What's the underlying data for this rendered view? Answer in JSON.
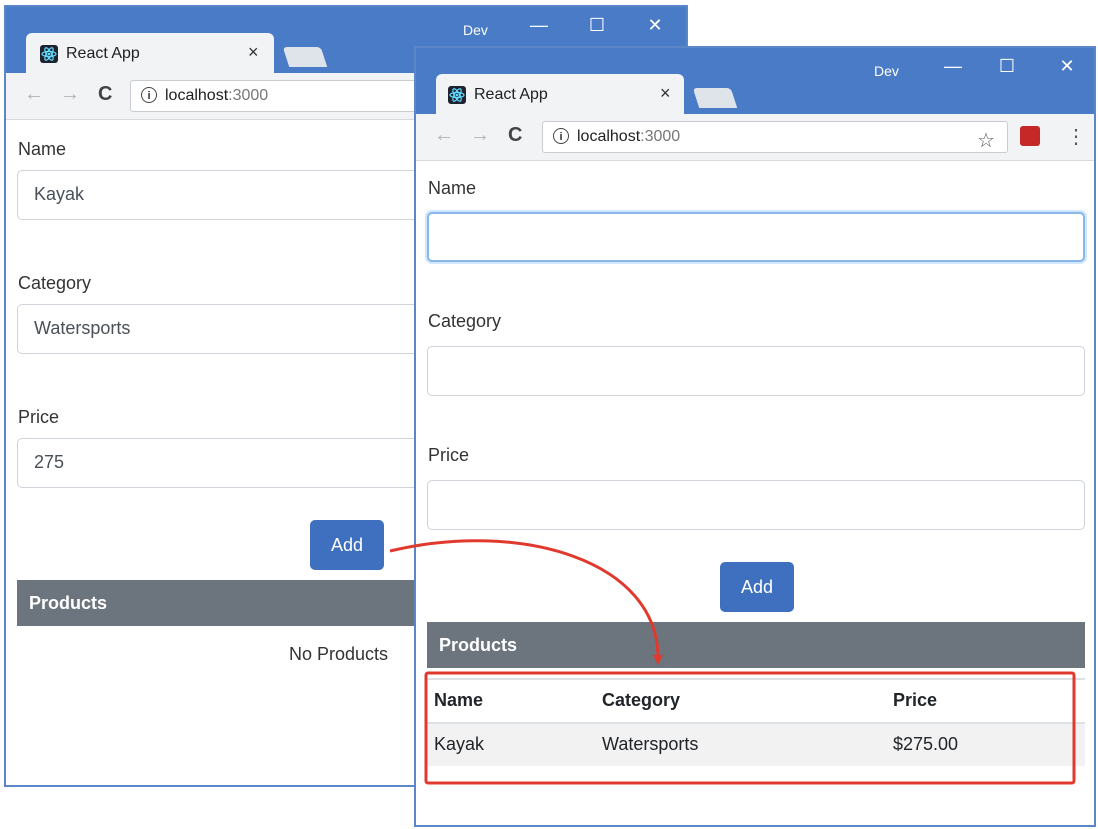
{
  "window_a": {
    "title_label": "Dev",
    "tab_title": "React App",
    "tab_close": "×",
    "url_host": "localhost",
    "url_port": ":3000",
    "form": {
      "name_label": "Name",
      "name_value": "Kayak",
      "category_label": "Category",
      "category_value": "Watersports",
      "price_label": "Price",
      "price_value": "275",
      "add_label": "Add"
    },
    "products": {
      "heading": "Products",
      "empty_text": "No Products"
    }
  },
  "window_b": {
    "title_label": "Dev",
    "tab_title": "React App",
    "tab_close": "×",
    "url_host": "localhost",
    "url_port": ":3000",
    "form": {
      "name_label": "Name",
      "name_value": "",
      "category_label": "Category",
      "category_value": "",
      "price_label": "Price",
      "price_value": "",
      "add_label": "Add"
    },
    "products": {
      "heading": "Products",
      "columns": [
        "Name",
        "Category",
        "Price"
      ],
      "rows": [
        [
          "Kayak",
          "Watersports",
          "$275.00"
        ]
      ]
    }
  },
  "icons": {
    "minimize": "—",
    "maximize": "☐",
    "close": "✕",
    "back": "←",
    "forward": "→",
    "reload": "C",
    "info": "i",
    "star": "☆",
    "menu": "⋮"
  },
  "colors": {
    "chrome_frame": "#4a7bc7",
    "button": "#3f6fbf",
    "products_header": "#6c757d",
    "annotation": "#e03a2f"
  }
}
